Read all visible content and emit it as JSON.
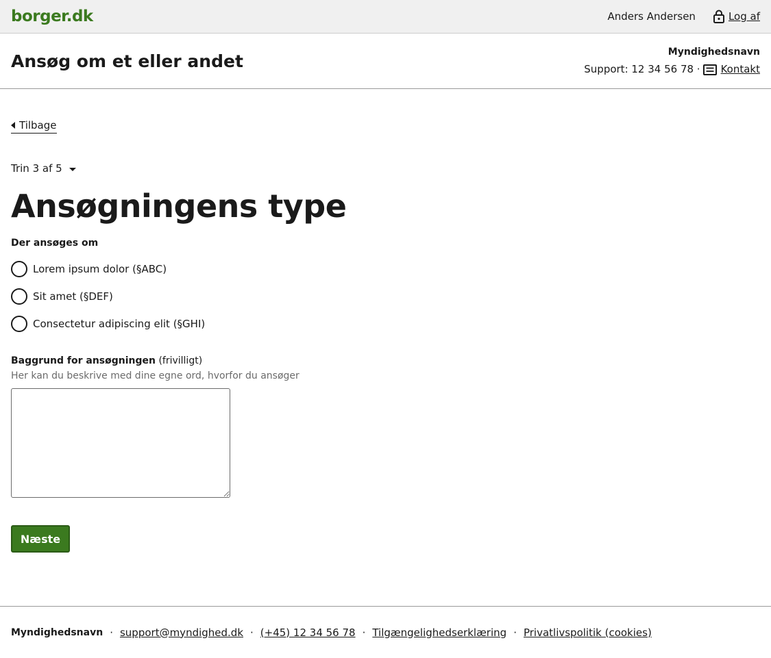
{
  "topbar": {
    "logo": "borger.dk",
    "user_name": "Anders Andersen",
    "logout_label": "Log af"
  },
  "header": {
    "title": "Ansøg om et eller andet",
    "authority": "Myndighedsnavn",
    "support_text": "Support: 12 34 56 78 ·",
    "contact_label": "Kontakt"
  },
  "main": {
    "back_label": "Tilbage",
    "step_label": "Trin 3 af 5",
    "page_title": "Ansøgningens type",
    "fieldset_legend": "Der ansøges om",
    "options": [
      "Lorem ipsum dolor (§ABC)",
      "Sit amet (§DEF)",
      "Consectetur adipiscing elit (§GHI)"
    ],
    "textarea_label": "Baggrund for ansøgningen",
    "textarea_optional": "(frivilligt)",
    "textarea_hint": "Her kan du beskrive med dine egne ord, hvorfor du ansøger",
    "textarea_value": "",
    "next_label": "Næste"
  },
  "footer": {
    "authority": "Myndighedsnavn",
    "separator": "·",
    "email": "support@myndighed.dk",
    "phone": "(+45) 12 34 56 78",
    "accessibility": "Tilgængelighedserklæring",
    "privacy": "Privatlivspolitik (cookies)"
  },
  "colors": {
    "brand_green": "#3b7a1f",
    "topbar_bg": "#f0f0f0",
    "text": "#1a1a1a",
    "hint": "#6b6b6b"
  },
  "icons": {
    "logout": "lock-icon",
    "contact": "message-icon",
    "back": "caret-left-icon",
    "step": "caret-down-icon"
  }
}
